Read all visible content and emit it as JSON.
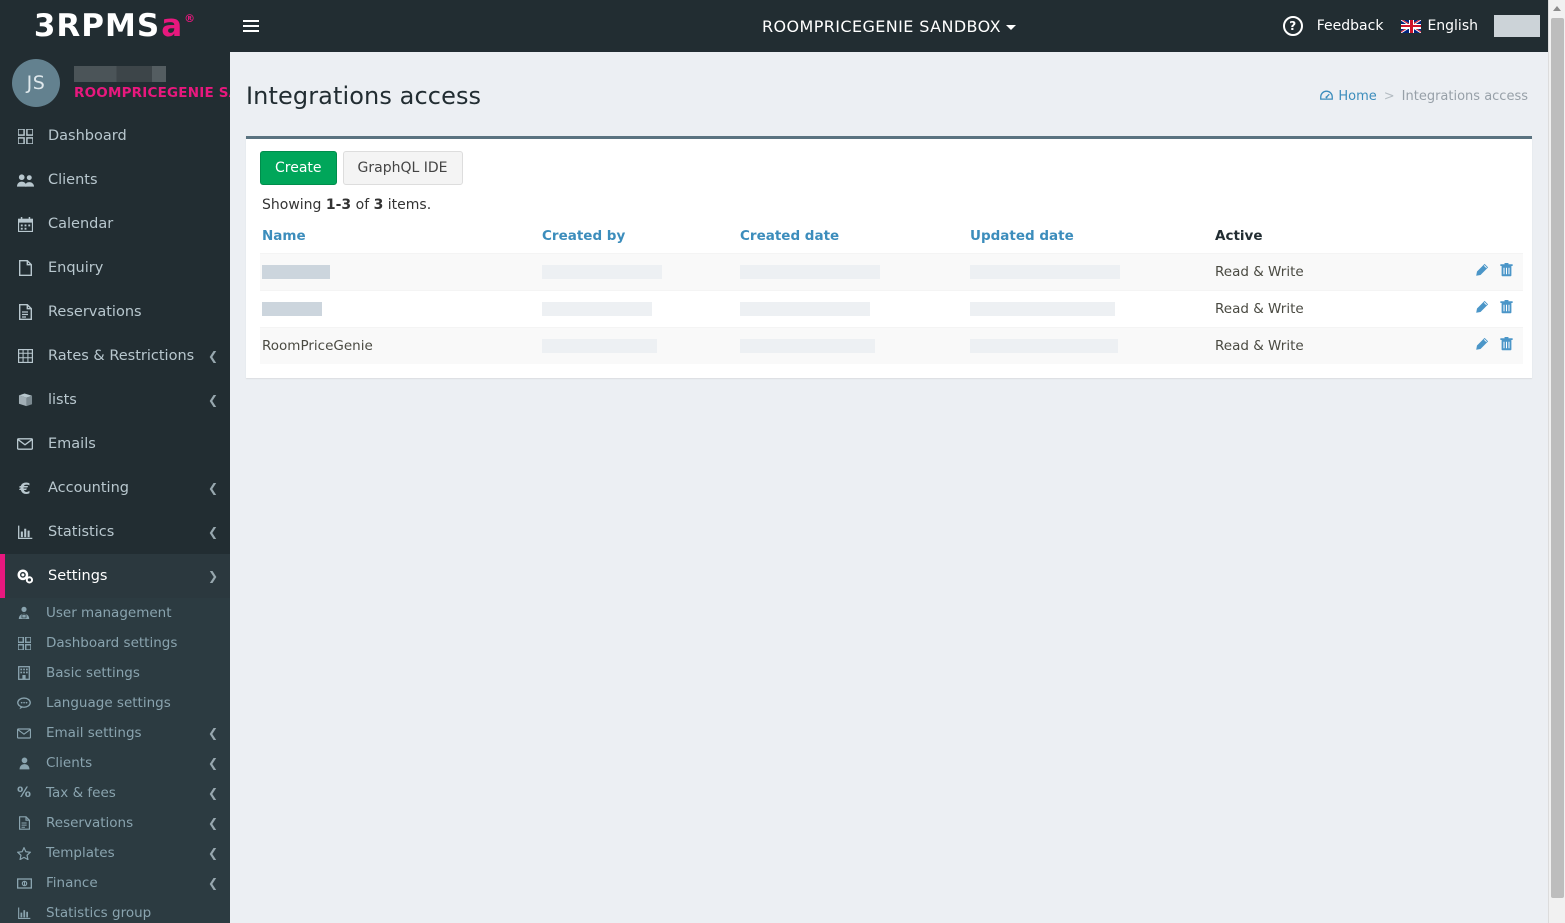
{
  "brand": {
    "name": "3RPMS",
    "mark": "a",
    "registered": "®"
  },
  "user": {
    "initials": "JS",
    "name_redacted": true,
    "hotel": "ROOMPRICEGENIE SANDBOX"
  },
  "header": {
    "menu_toggle": "menu-icon",
    "title": "ROOMPRICEGENIE SANDBOX",
    "help": "?",
    "feedback": "Feedback",
    "language": "English",
    "account_redacted": true
  },
  "sidebar": {
    "items": [
      {
        "label": "Dashboard",
        "icon": "dashboard-icon",
        "expandable": false,
        "active": false
      },
      {
        "label": "Clients",
        "icon": "users-icon",
        "expandable": false,
        "active": false
      },
      {
        "label": "Calendar",
        "icon": "calendar-icon",
        "expandable": false,
        "active": false
      },
      {
        "label": "Enquiry",
        "icon": "file-icon",
        "expandable": false,
        "active": false
      },
      {
        "label": "Reservations",
        "icon": "document-icon",
        "expandable": false,
        "active": false
      },
      {
        "label": "Rates & Restrictions",
        "icon": "table-icon",
        "expandable": true,
        "active": false
      },
      {
        "label": "lists",
        "icon": "book-icon",
        "expandable": true,
        "active": false
      },
      {
        "label": "Emails",
        "icon": "envelope-icon",
        "expandable": false,
        "active": false
      },
      {
        "label": "Accounting",
        "icon": "euro-icon",
        "expandable": true,
        "active": false
      },
      {
        "label": "Statistics",
        "icon": "bar-chart-icon",
        "expandable": true,
        "active": false
      },
      {
        "label": "Settings",
        "icon": "gears-icon",
        "expandable": true,
        "active": true
      }
    ],
    "settings_submenu": [
      {
        "label": "User management",
        "icon": "lock-user-icon",
        "expandable": false
      },
      {
        "label": "Dashboard settings",
        "icon": "dashboard-icon",
        "expandable": false
      },
      {
        "label": "Basic settings",
        "icon": "building-icon",
        "expandable": false
      },
      {
        "label": "Language settings",
        "icon": "comment-icon",
        "expandable": false
      },
      {
        "label": "Email settings",
        "icon": "envelope-icon",
        "expandable": true
      },
      {
        "label": "Clients",
        "icon": "user-icon",
        "expandable": true
      },
      {
        "label": "Tax & fees",
        "icon": "percent-icon",
        "expandable": true
      },
      {
        "label": "Reservations",
        "icon": "document-icon",
        "expandable": true
      },
      {
        "label": "Templates",
        "icon": "star-icon",
        "expandable": true
      },
      {
        "label": "Finance",
        "icon": "money-icon",
        "expandable": true
      },
      {
        "label": "Statistics group",
        "icon": "bar-chart-icon",
        "expandable": false
      }
    ]
  },
  "page": {
    "title": "Integrations access",
    "breadcrumb": {
      "home": "Home",
      "separator": ">",
      "current": "Integrations access"
    }
  },
  "toolbar": {
    "create_label": "Create",
    "graphql_label": "GraphQL IDE"
  },
  "table": {
    "summary_prefix": "Showing ",
    "summary_range": "1-3",
    "summary_mid": " of ",
    "summary_total": "3",
    "summary_suffix": " items.",
    "columns": [
      {
        "label": "Name",
        "sortable": true
      },
      {
        "label": "Created by",
        "sortable": true
      },
      {
        "label": "Created date",
        "sortable": true
      },
      {
        "label": "Updated date",
        "sortable": true
      },
      {
        "label": "Active",
        "sortable": false
      }
    ],
    "rows": [
      {
        "name": "",
        "name_redacted": true,
        "created_by": "",
        "created_date": "",
        "updated_date": "",
        "active": "Read & Write"
      },
      {
        "name": "",
        "name_redacted": true,
        "created_by": "",
        "created_date": "",
        "updated_date": "",
        "active": "Read & Write"
      },
      {
        "name": "RoomPriceGenie",
        "name_redacted": false,
        "created_by": "",
        "created_date": "",
        "updated_date": "",
        "active": "Read & Write"
      }
    ],
    "row_actions": {
      "edit": "pencil-icon",
      "delete": "trash-icon"
    }
  },
  "colors": {
    "sidebar_bg": "#222d32",
    "accent_pink": "#e8187e",
    "link_blue": "#3c8dbc",
    "create_green": "#00a65a",
    "panel_top_border": "#5a7380"
  }
}
